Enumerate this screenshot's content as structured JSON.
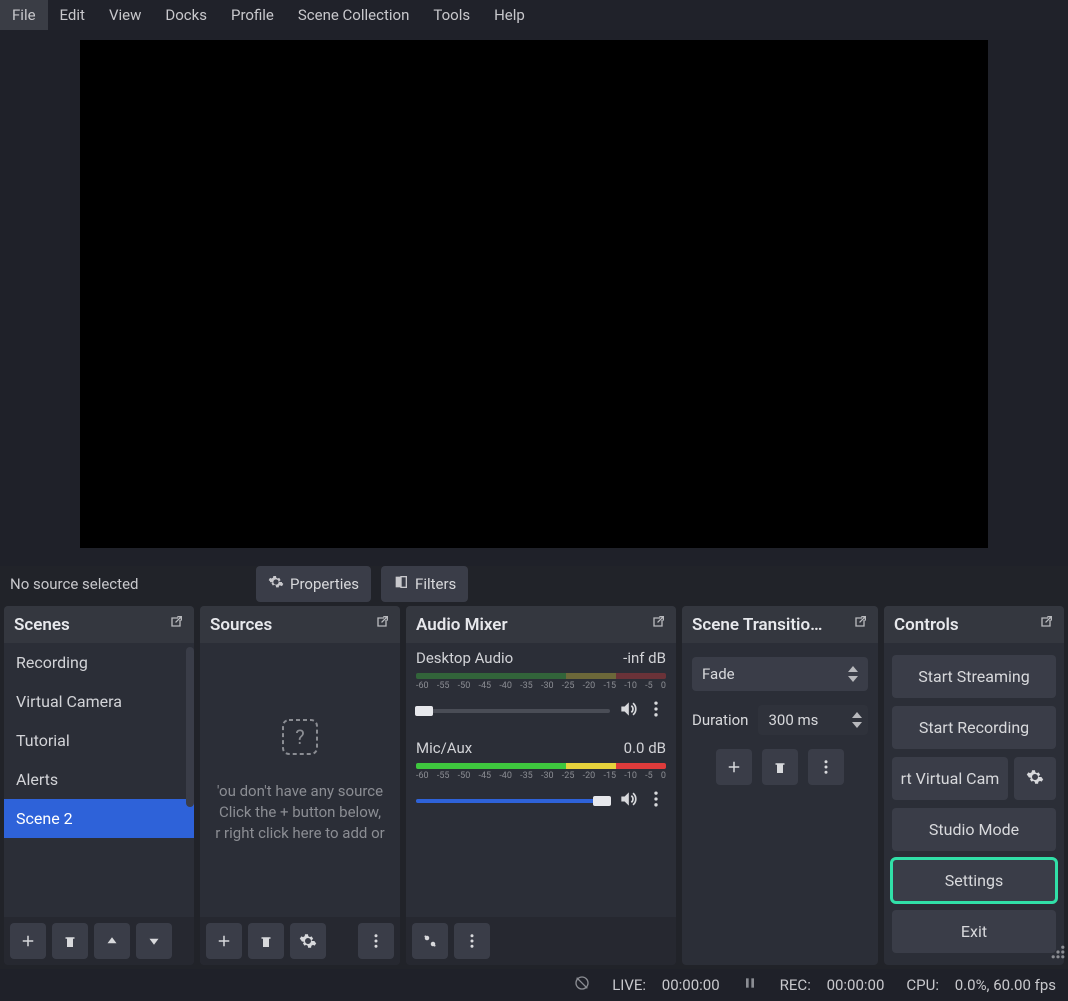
{
  "menu": {
    "items": [
      "File",
      "Edit",
      "View",
      "Docks",
      "Profile",
      "Scene Collection",
      "Tools",
      "Help"
    ]
  },
  "source_toolbar": {
    "message": "No source selected",
    "properties_label": "Properties",
    "filters_label": "Filters"
  },
  "panels": {
    "scenes_title": "Scenes",
    "sources_title": "Sources",
    "mixer_title": "Audio Mixer",
    "transitions_title": "Scene Transitio…",
    "controls_title": "Controls"
  },
  "scenes": {
    "items": [
      "Recording",
      "Virtual Camera",
      "Tutorial",
      "Alerts",
      "Scene 2"
    ],
    "selected_index": 4
  },
  "sources": {
    "empty_line1": "'ou don't have any source",
    "empty_line2": "Click the + button below,",
    "empty_line3": "r right click here to add or"
  },
  "mixer": {
    "ticks": [
      "-60",
      "-55",
      "-50",
      "-45",
      "-40",
      "-35",
      "-30",
      "-25",
      "-20",
      "-15",
      "-10",
      "-5",
      "0"
    ],
    "tracks": [
      {
        "name": "Desktop Audio",
        "level": "-inf dB",
        "slider_pct": 4,
        "muted": true
      },
      {
        "name": "Mic/Aux",
        "level": "0.0 dB",
        "slider_pct": 96,
        "muted": false
      }
    ]
  },
  "transitions": {
    "selected": "Fade",
    "duration_label": "Duration",
    "duration_value": "300 ms"
  },
  "controls": {
    "start_streaming": "Start Streaming",
    "start_recording": "Start Recording",
    "virtual_cam": "rt Virtual Cam",
    "studio_mode": "Studio Mode",
    "settings": "Settings",
    "exit": "Exit"
  },
  "status": {
    "live_label": "LIVE:",
    "live_time": "00:00:00",
    "rec_label": "REC:",
    "rec_time": "00:00:00",
    "cpu_label": "CPU:",
    "cpu_value": "0.0%, 60.00 fps"
  }
}
